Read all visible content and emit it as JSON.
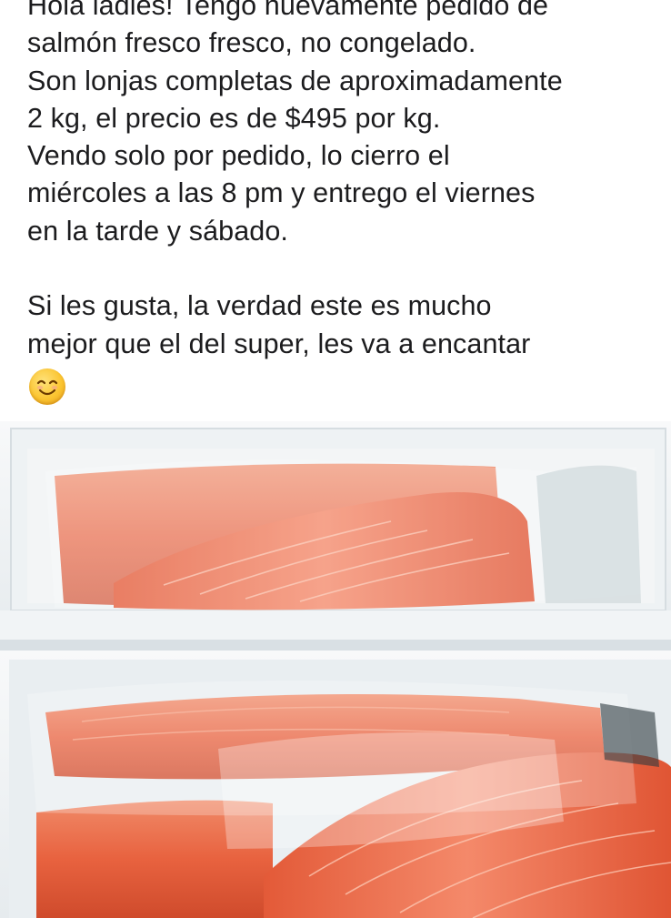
{
  "post": {
    "lines": [
      "Hola ladies! Tengo nuevamente pedido de",
      "salmón fresco fresco, no congelado.",
      "Son lonjas completas de aproximadamente",
      "2 kg, el precio es de $495 por kg.",
      "Vendo solo por pedido, lo cierro el",
      "miércoles a las 8 pm y entrego el viernes",
      "en la tarde y sábado.",
      "",
      "Si les gusta, la verdad este es mucho",
      "mejor que el del super, les va a encantar"
    ],
    "emoji_icon": "smiling-face-emoji"
  },
  "photo": {
    "subject_icon": "salmon-fillets-in-cooler-photo",
    "colors": {
      "salmon": "#e8623f",
      "salmon_light": "#f4896a",
      "styrofoam": "#f4f6f7",
      "plastic": "#dfe7ea"
    }
  }
}
